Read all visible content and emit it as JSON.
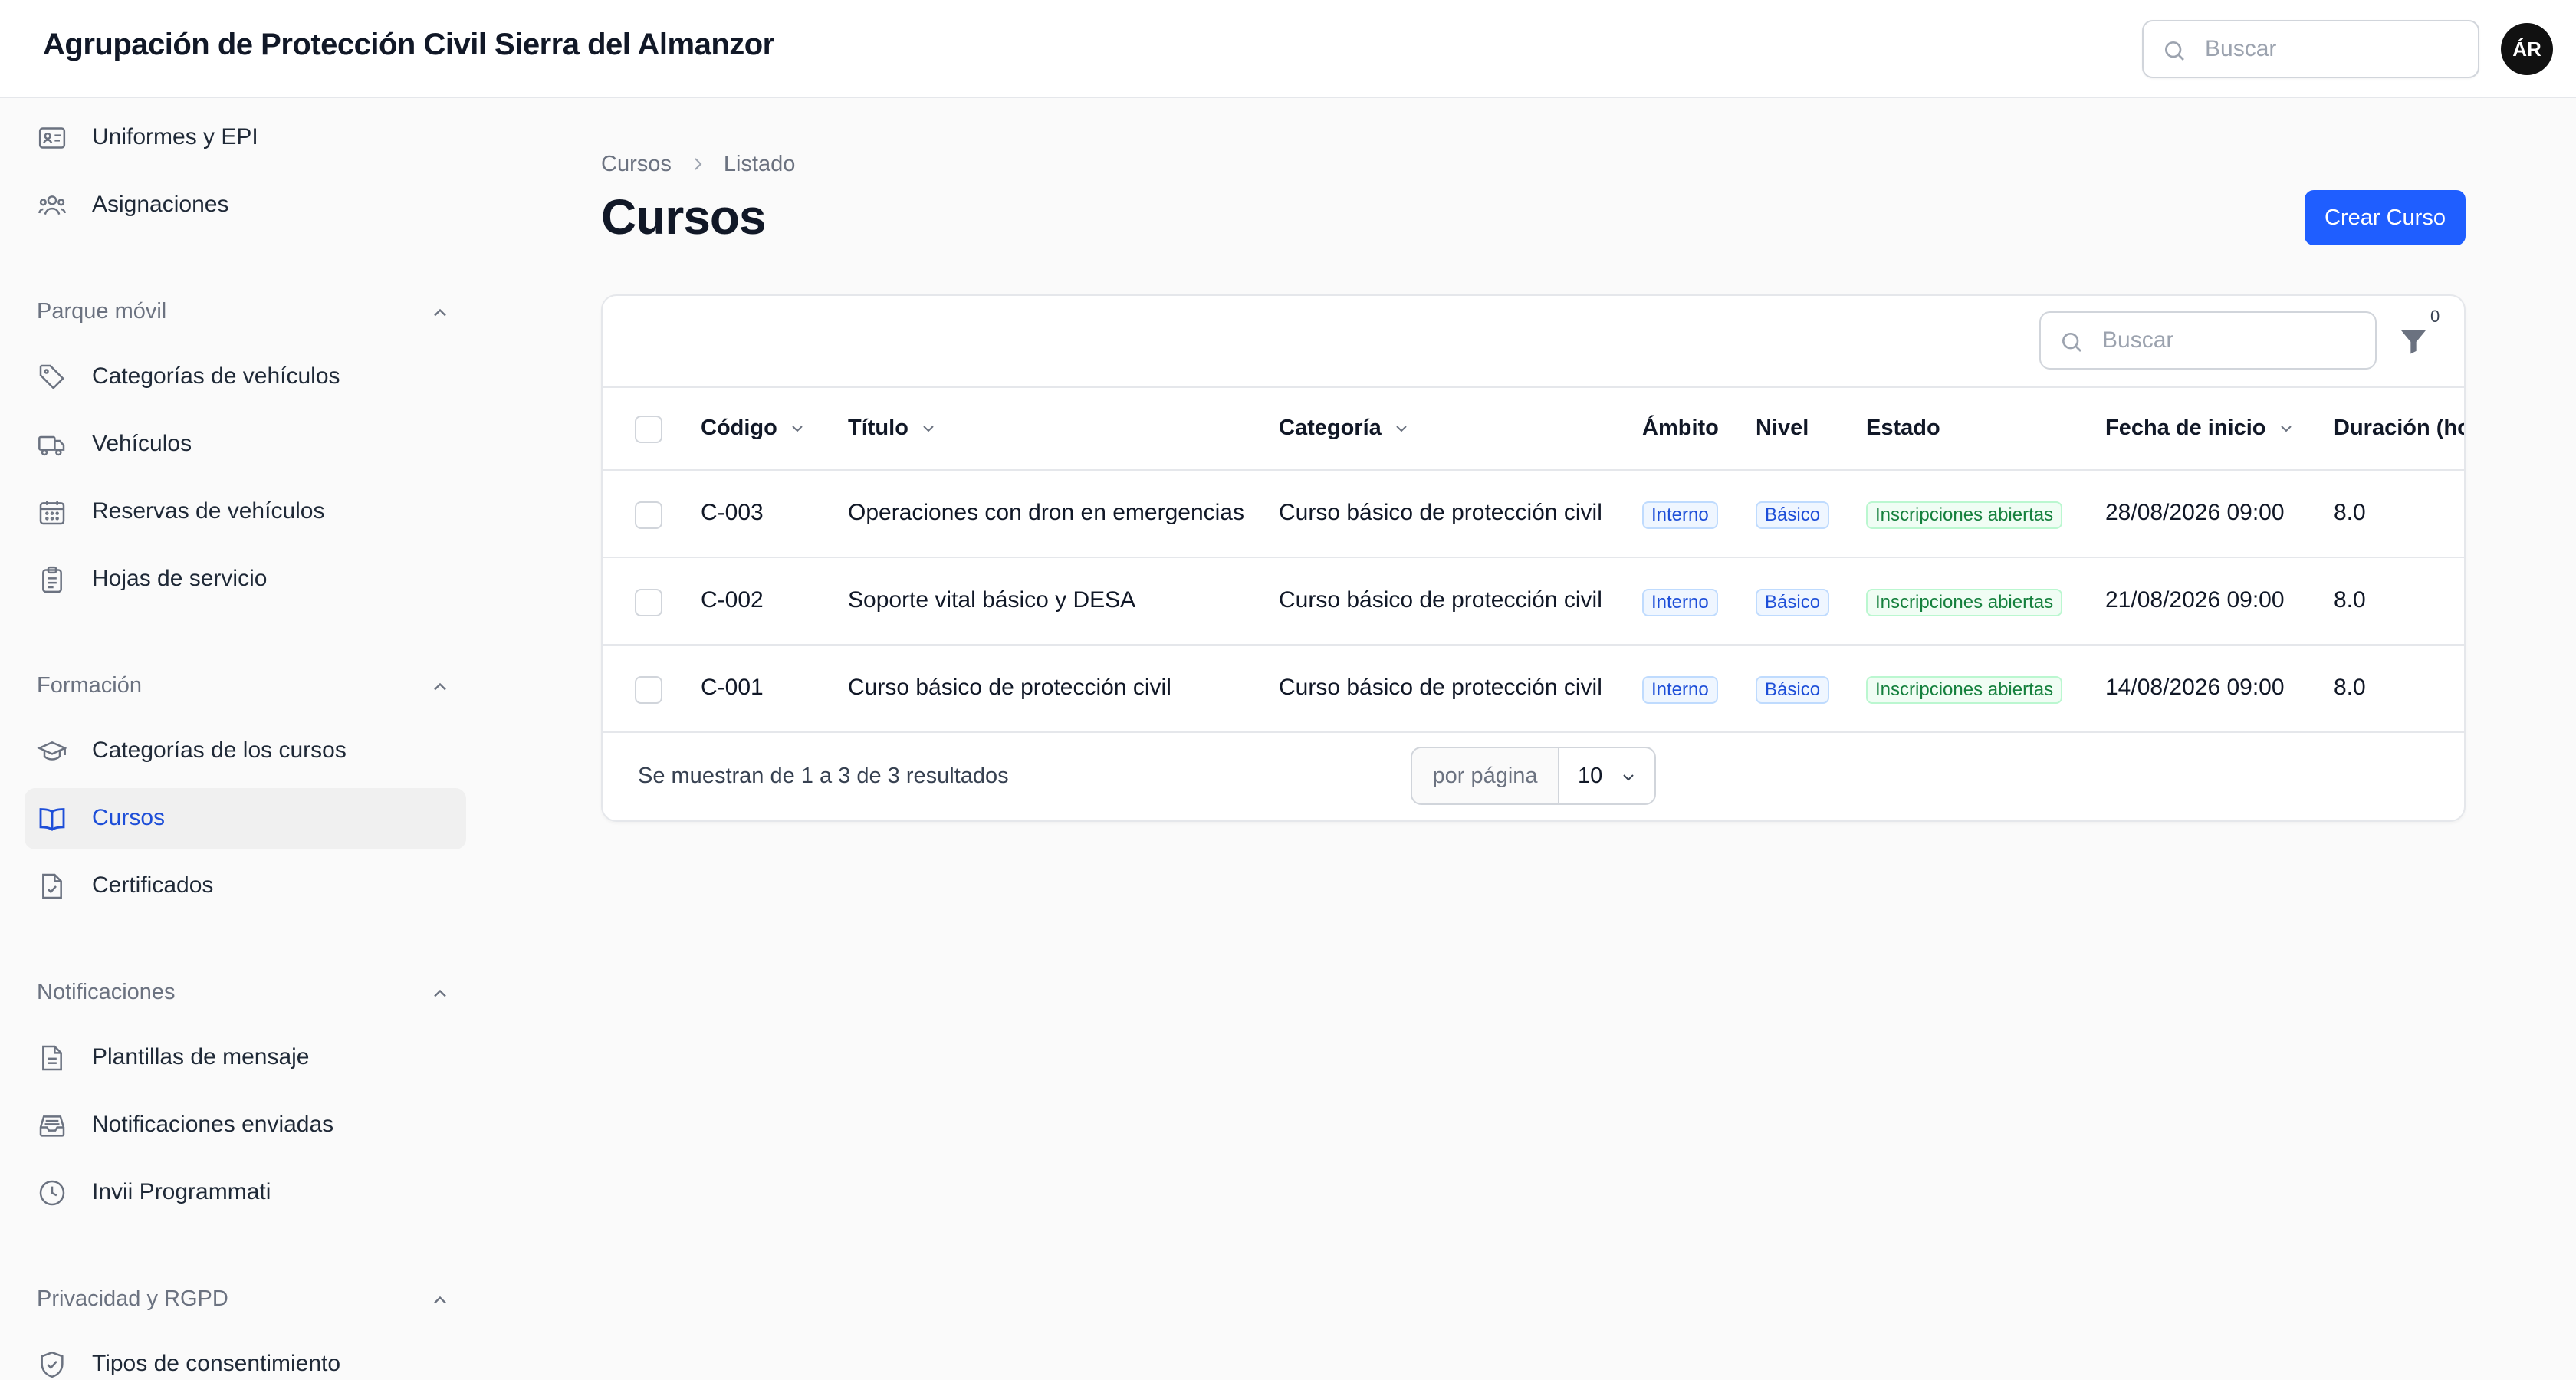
{
  "app": {
    "title": "Agrupación de Protección Civil Sierra del Almanzor",
    "search_placeholder": "Buscar",
    "avatar_initials": "ÁR"
  },
  "sidebar": {
    "items_top": [
      {
        "label": "Uniformes y EPI",
        "icon": "id-card-icon"
      },
      {
        "label": "Asignaciones",
        "icon": "users-icon"
      }
    ],
    "groups": [
      {
        "label": "Parque móvil",
        "items": [
          {
            "label": "Categorías de vehículos",
            "icon": "tag-icon"
          },
          {
            "label": "Vehículos",
            "icon": "truck-icon"
          },
          {
            "label": "Reservas de vehículos",
            "icon": "calendar-icon"
          },
          {
            "label": "Hojas de servicio",
            "icon": "clipboard-icon"
          }
        ]
      },
      {
        "label": "Formación",
        "items": [
          {
            "label": "Categorías de los cursos",
            "icon": "graduation-cap-icon"
          },
          {
            "label": "Cursos",
            "icon": "book-open-icon",
            "active": true
          },
          {
            "label": "Certificados",
            "icon": "document-check-icon"
          }
        ]
      },
      {
        "label": "Notificaciones",
        "items": [
          {
            "label": "Plantillas de mensaje",
            "icon": "document-text-icon"
          },
          {
            "label": "Notificaciones enviadas",
            "icon": "inbox-icon"
          },
          {
            "label": "Invii Programmati",
            "icon": "clock-icon"
          }
        ]
      },
      {
        "label": "Privacidad y RGPD",
        "items": [
          {
            "label": "Tipos de consentimiento",
            "icon": "shield-check-icon"
          }
        ]
      }
    ]
  },
  "breadcrumb": {
    "parent": "Cursos",
    "current": "Listado"
  },
  "page": {
    "title": "Cursos",
    "create_button": "Crear Curso"
  },
  "table": {
    "search_placeholder": "Buscar",
    "filter_count": "0",
    "columns": [
      "Código",
      "Título",
      "Categoría",
      "Ámbito",
      "Nivel",
      "Estado",
      "Fecha de inicio",
      "Duración (ho"
    ],
    "rows": [
      {
        "codigo": "C-003",
        "titulo": "Operaciones con dron en emergencias",
        "categoria": "Curso básico de protección civil",
        "ambito": "Interno",
        "nivel": "Básico",
        "estado": "Inscripciones abiertas",
        "fecha": "28/08/2026 09:00",
        "duracion": "8.0"
      },
      {
        "codigo": "C-002",
        "titulo": "Soporte vital básico y DESA",
        "categoria": "Curso básico de protección civil",
        "ambito": "Interno",
        "nivel": "Básico",
        "estado": "Inscripciones abiertas",
        "fecha": "21/08/2026 09:00",
        "duracion": "8.0"
      },
      {
        "codigo": "C-001",
        "titulo": "Curso básico de protección civil",
        "categoria": "Curso básico de protección civil",
        "ambito": "Interno",
        "nivel": "Básico",
        "estado": "Inscripciones abiertas",
        "fecha": "14/08/2026 09:00",
        "duracion": "8.0"
      }
    ],
    "footer_text": "Se muestran de 1 a 3 de 3 resultados",
    "per_page_label": "por página",
    "per_page_value": "10"
  },
  "colors": {
    "primary": "#1f5eff",
    "active_text": "#1d4ed8",
    "badge_blue": "#1d4ed8",
    "badge_green": "#15803d"
  }
}
